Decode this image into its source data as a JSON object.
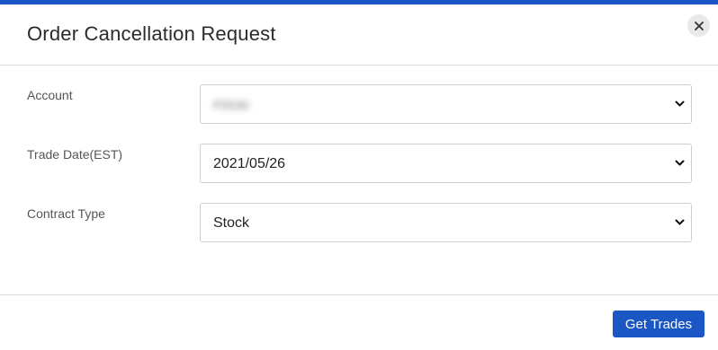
{
  "dialog": {
    "title": "Order Cancellation Request",
    "accent_color": "#1a56c4"
  },
  "form": {
    "account": {
      "label": "Account",
      "value": "F5530"
    },
    "trade_date": {
      "label": "Trade Date(EST)",
      "value": "2021/05/26"
    },
    "contract_type": {
      "label": "Contract Type",
      "value": "Stock"
    }
  },
  "footer": {
    "primary_button_label": "Get Trades"
  },
  "icons": {
    "close": "close-icon",
    "dropdown": "chevron-down-icon"
  }
}
